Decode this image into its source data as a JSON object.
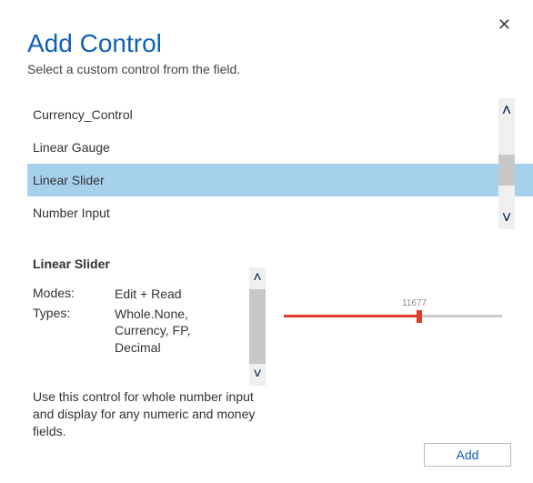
{
  "close_label": "✕",
  "header": {
    "title": "Add Control",
    "subtitle": "Select a custom control from the field."
  },
  "controls": {
    "items": [
      {
        "label": "Currency_Control",
        "selected": false
      },
      {
        "label": "Linear Gauge",
        "selected": false
      },
      {
        "label": "Linear Slider",
        "selected": true
      },
      {
        "label": "Number Input",
        "selected": false
      }
    ]
  },
  "detail": {
    "title": "Linear Slider",
    "modes_label": "Modes:",
    "modes_value": "Edit + Read",
    "types_label": "Types:",
    "types_value": "Whole.None, Currency, FP, Decimal",
    "description": "Use this control for whole number input and display for any numeric and money fields."
  },
  "preview": {
    "value_label": "11677"
  },
  "footer": {
    "add_label": "Add"
  },
  "icons": {
    "up": "˄",
    "down": "˅"
  }
}
